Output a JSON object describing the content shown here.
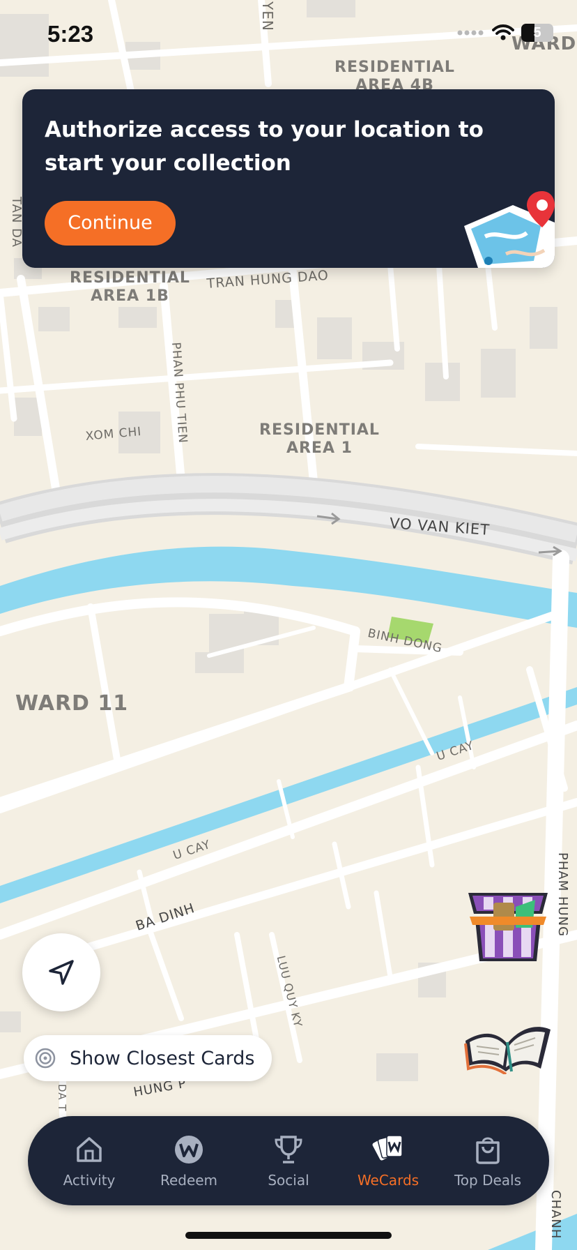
{
  "status_bar": {
    "time": "5:23",
    "battery_level": "5",
    "icons": [
      "signal-dots-icon",
      "wifi-icon",
      "battery-icon"
    ]
  },
  "map": {
    "labels": {
      "top_street": "YEN",
      "ward_top_right": "WARD",
      "residential_4b_line1": "RESIDENTIAL",
      "residential_4b_line2": "AREA 4B",
      "tan_da": "TAN DA",
      "residential_1b_line1": "RESIDENTIAL",
      "residential_1b_line2": "AREA 1B",
      "tran_hung_dao": "TRAN HUNG DAO",
      "phan_phu_tien": "PHAN PHU TIEN",
      "xom_chi": "XOM CHI",
      "residential_1_line1": "RESIDENTIAL",
      "residential_1_line2": "AREA 1",
      "vo_van_kiet": "VO VAN KIET",
      "binh_dong": "BINH DONG",
      "ward_11": "WARD 11",
      "u_cay_right": "U CAY",
      "u_cay_left": "U CAY",
      "pham_hung": "PHAM HUNG",
      "ba_dinh": "BA DINH",
      "luu_quy_ky": "LUU QUY KY",
      "hung_partial": "HUNG P",
      "da_t": "DA T",
      "chanh": "CHANH"
    }
  },
  "banner": {
    "message": "Authorize access to your location to start your collection",
    "button_label": "Continue",
    "illustration": "map-pin-illustration"
  },
  "floating": {
    "locate_icon": "navigation-arrow-icon",
    "closest_cards_label": "Show Closest Cards",
    "chest_icon": "treasure-chest-icon",
    "book_icon": "open-book-icon"
  },
  "bottom_nav": {
    "active": "WeCards",
    "items": [
      {
        "label": "Activity",
        "icon": "home-icon"
      },
      {
        "label": "Redeem",
        "icon": "w-coin-icon"
      },
      {
        "label": "Social",
        "icon": "trophy-icon"
      },
      {
        "label": "WeCards",
        "icon": "cards-icon"
      },
      {
        "label": "Top Deals",
        "icon": "shopping-bag-icon"
      }
    ]
  },
  "colors": {
    "map_background": "#f4efe3",
    "road": "#ffffff",
    "water": "#8ed8f0",
    "park": "#a6d86e",
    "building": "#e3e0da",
    "banner_background": "#1d2538",
    "accent": "#f56f26",
    "nav_inactive": "#a8b0c0"
  }
}
